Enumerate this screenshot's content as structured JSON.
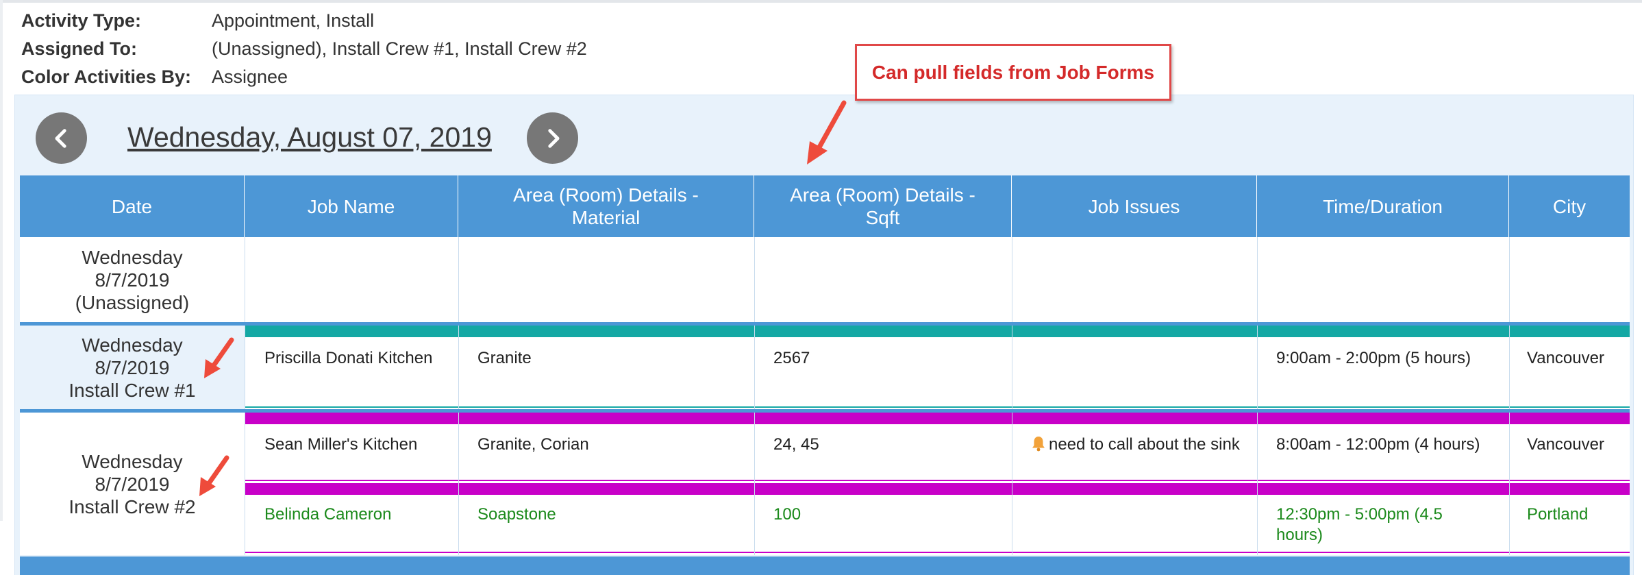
{
  "filters": [
    {
      "label": "Activity Type:",
      "value": "Appointment, Install"
    },
    {
      "label": "Assigned To:",
      "value": "(Unassigned), Install Crew #1, Install Crew #2"
    },
    {
      "label": "Color Activities By:",
      "value": "Assignee"
    }
  ],
  "navigation": {
    "current_date": "Wednesday, August 07, 2019",
    "prev_icon": "chevron-left-icon",
    "next_icon": "chevron-right-icon"
  },
  "annotation": {
    "callout_text": "Can pull fields from Job Forms"
  },
  "table": {
    "columns": [
      "Date",
      "Job Name",
      "Area (Room) Details - Material",
      "Area (Room) Details - Sqft",
      "Job Issues",
      "Time/Duration",
      "City"
    ],
    "groups": [
      {
        "date_line1": "Wednesday",
        "date_line2": "8/7/2019",
        "assignee": "(Unassigned)",
        "rows": []
      },
      {
        "date_line1": "Wednesday",
        "date_line2": "8/7/2019",
        "assignee": "Install Crew #1",
        "color": "#14a8a4",
        "rows": [
          {
            "job_name": "Priscilla Donati Kitchen",
            "material": "Granite",
            "sqft": "2567",
            "issues": "",
            "time": "9:00am - 2:00pm (5 hours)",
            "city": "Vancouver"
          }
        ]
      },
      {
        "date_line1": "Wednesday",
        "date_line2": "8/7/2019",
        "assignee": "Install Crew #2",
        "color": "#c800c8",
        "rows": [
          {
            "job_name": "Sean Miller's Kitchen",
            "material": "Granite, Corian",
            "sqft": "24, 45",
            "issues": "need to call about the sink",
            "issue_icon": "bell-icon",
            "time": "8:00am - 12:00pm (4 hours)",
            "city": "Vancouver"
          },
          {
            "job_name": "Belinda Cameron",
            "material": "Soapstone",
            "sqft": "100",
            "issues": "",
            "time": "12:30pm - 5:00pm (4.5 hours)",
            "city": "Portland"
          }
        ]
      }
    ]
  },
  "colors": {
    "header_blue": "#4d97d6",
    "panel_bg": "#e8f2fb",
    "crew1": "#14a8a4",
    "crew2": "#c800c8",
    "callout_red": "#d42a2a",
    "completed_green": "#1c8a1c"
  }
}
